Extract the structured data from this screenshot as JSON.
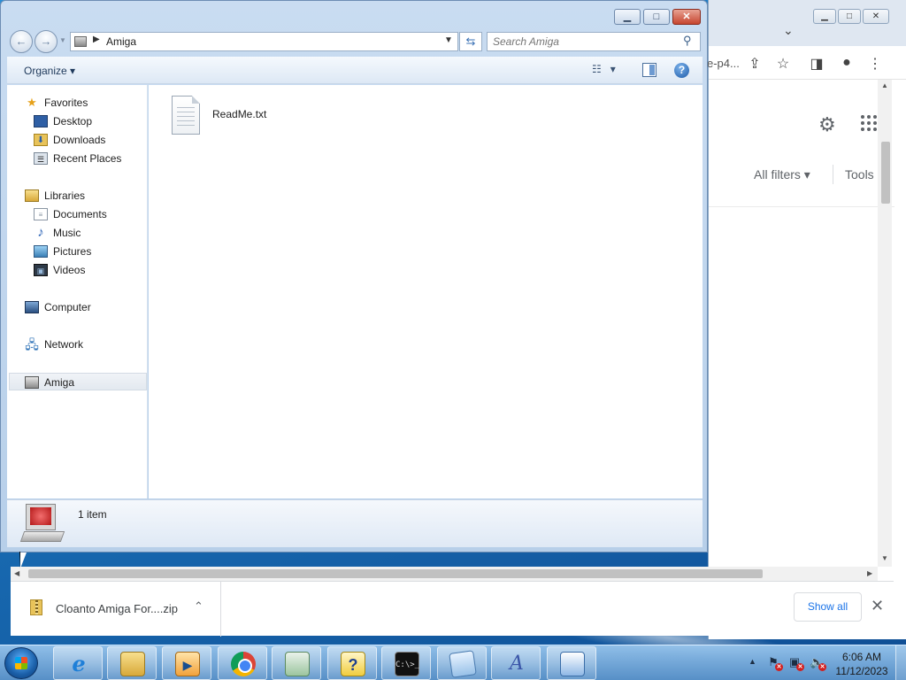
{
  "explorer": {
    "address": "Amiga",
    "search_placeholder": "Search Amiga",
    "organize_label": "Organize",
    "caption": {
      "minimize": "▁",
      "maximize": "□",
      "close": "✕"
    },
    "nav": {
      "favorites": {
        "label": "Favorites",
        "icon": "star-icon"
      },
      "favorites_items": [
        {
          "label": "Desktop",
          "icon": "desktop-icon"
        },
        {
          "label": "Downloads",
          "icon": "downloads-icon"
        },
        {
          "label": "Recent Places",
          "icon": "recent-places-icon"
        }
      ],
      "libraries": {
        "label": "Libraries",
        "icon": "libraries-icon"
      },
      "libraries_items": [
        {
          "label": "Documents",
          "icon": "documents-icon"
        },
        {
          "label": "Music",
          "icon": "music-icon"
        },
        {
          "label": "Pictures",
          "icon": "pictures-icon"
        },
        {
          "label": "Videos",
          "icon": "videos-icon"
        }
      ],
      "computer": {
        "label": "Computer",
        "icon": "computer-icon"
      },
      "network": {
        "label": "Network",
        "icon": "network-icon"
      },
      "amiga": {
        "label": "Amiga",
        "icon": "amiga-drive-icon",
        "selected": true
      }
    },
    "files": [
      {
        "name": "ReadMe.txt",
        "icon": "text-file-icon"
      }
    ],
    "details": {
      "item_count": "1 item"
    }
  },
  "browser": {
    "url_fragment": "e-p4...",
    "all_filters": "All filters",
    "tools": "Tools",
    "downloads": {
      "item_name": "Cloanto Amiga For....zip",
      "show_all": "Show all"
    }
  },
  "taskbar": {
    "clock_time": "6:06 AM",
    "clock_date": "11/12/2023",
    "apps": [
      "internet-explorer-icon",
      "windows-explorer-icon",
      "media-player-icon",
      "chrome-icon",
      "document-viewer-icon",
      "help-icon",
      "command-prompt-icon",
      "notepad-icon",
      "font-editor-icon",
      "keyboard-icon"
    ]
  },
  "colors": {
    "desktop": "#1a6fb6",
    "explorer_frame": "#c9dcf1",
    "accent_blue": "#1a73e8",
    "close_red": "#c6452f"
  }
}
